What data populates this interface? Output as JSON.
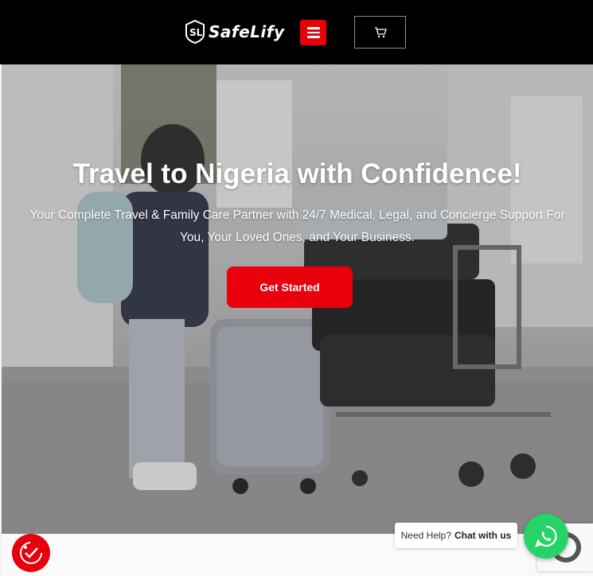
{
  "header": {
    "logo_text": "SafeLify",
    "menu_icon": "hamburger-icon",
    "cart_icon": "cart-icon"
  },
  "hero": {
    "title": "Travel to Nigeria with Confidence!",
    "subtitle_line1": "Your Complete Travel & Family Care Partner with 24/7 Medical, Legal, and Concierge Support For",
    "subtitle_line2": "You, Your Loved Ones, and Your Business.",
    "cta_label": "Get Started"
  },
  "chat": {
    "prefix": "Need Help?",
    "link": "Chat with us",
    "icon": "whatsapp-icon"
  },
  "badge": {
    "icon": "checkmark-badge-icon"
  },
  "colors": {
    "accent": "#e8000b",
    "header_bg": "#000000",
    "whatsapp": "#25d366"
  }
}
